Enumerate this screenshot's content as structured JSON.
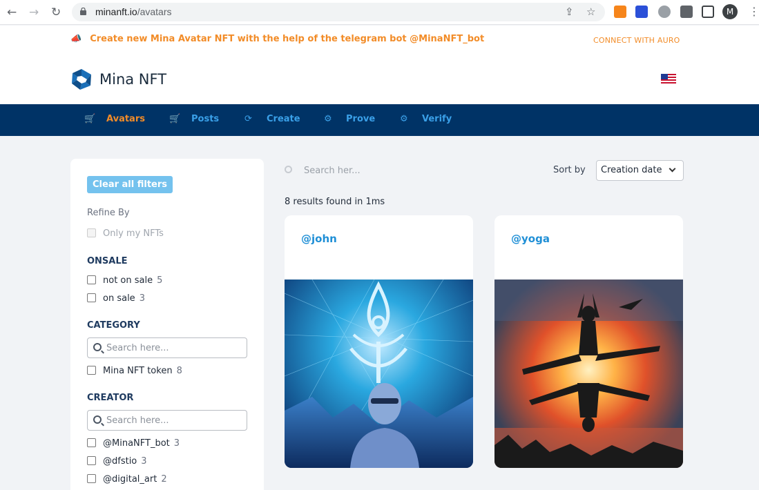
{
  "browser": {
    "url_host": "minanft.io",
    "url_path": "/avatars",
    "profile_initial": "M"
  },
  "announcement": {
    "text": "Create new Mina Avatar NFT with the help of the telegram bot @MinaNFT_bot",
    "connect_label": "CONNECT WITH AURO"
  },
  "brand": {
    "name": "Mina NFT"
  },
  "nav": {
    "items": [
      {
        "label": "Avatars",
        "icon": "cart-icon",
        "active": true
      },
      {
        "label": "Posts",
        "icon": "cart-icon",
        "active": false
      },
      {
        "label": "Create",
        "icon": "refresh-icon",
        "active": false
      },
      {
        "label": "Prove",
        "icon": "gear-icon",
        "active": false
      },
      {
        "label": "Verify",
        "icon": "gear-icon",
        "active": false
      }
    ]
  },
  "filters": {
    "clear_label": "Clear all filters",
    "refine_label": "Refine By",
    "only_mine_label": "Only my NFTs",
    "onsale": {
      "title": "ONSALE",
      "items": [
        {
          "label": "not on sale",
          "count": "5"
        },
        {
          "label": "on sale",
          "count": "3"
        }
      ]
    },
    "category": {
      "title": "CATEGORY",
      "search_placeholder": "Search here...",
      "items": [
        {
          "label": "Mina NFT token",
          "count": "8"
        }
      ]
    },
    "creator": {
      "title": "CREATOR",
      "search_placeholder": "Search here...",
      "items": [
        {
          "label": "@MinaNFT_bot",
          "count": "3"
        },
        {
          "label": "@dfstio",
          "count": "3"
        },
        {
          "label": "@digital_art",
          "count": "2"
        }
      ]
    }
  },
  "search": {
    "placeholder": "Search her..."
  },
  "sort": {
    "label": "Sort by",
    "value": "Creation date"
  },
  "results_text": "8 results found in 1ms",
  "cards": [
    {
      "handle": "@john"
    },
    {
      "handle": "@yoga"
    }
  ],
  "colors": {
    "accent_orange": "#f28c28",
    "nav_bg": "#003366",
    "link_blue": "#1f8fd6"
  }
}
